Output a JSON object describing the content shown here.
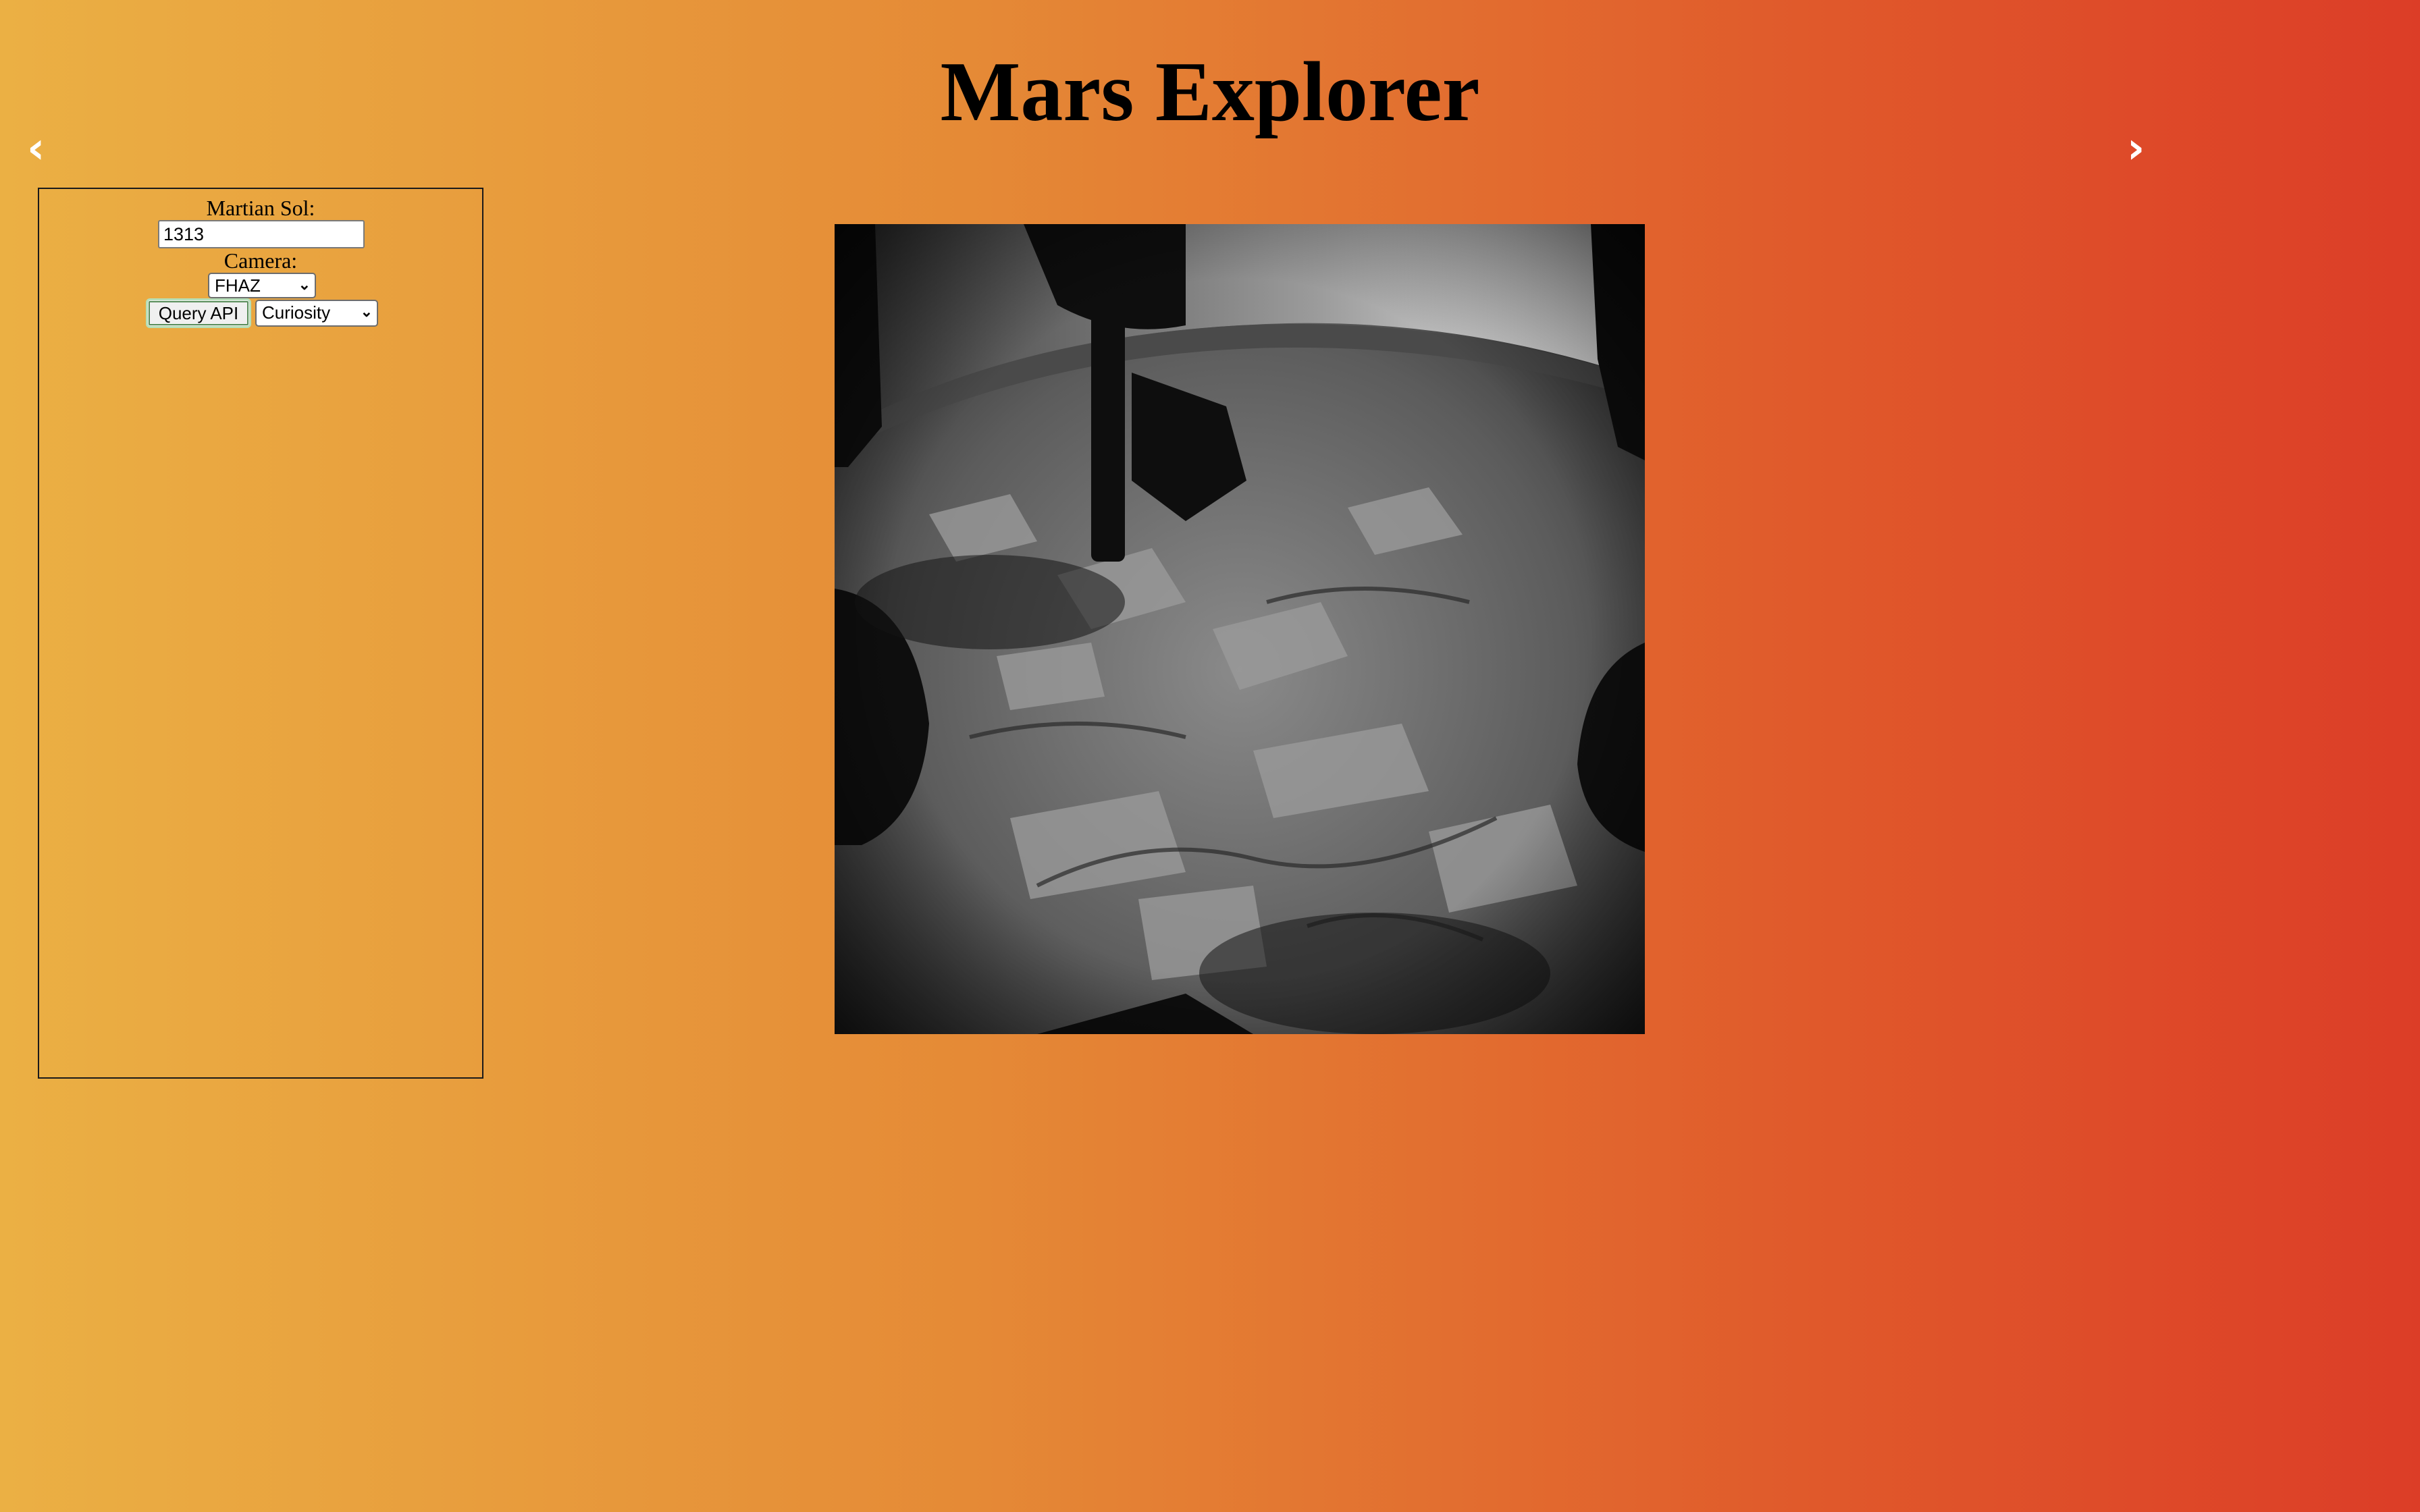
{
  "page": {
    "title": "Mars Explorer",
    "gradient_colors": [
      "#ebb044",
      "#e58a36",
      "#e0592b",
      "#dc3d27"
    ]
  },
  "nav": {
    "prev_label": "‹",
    "next_label": "›",
    "prev_icon": "chevron-left-icon",
    "next_icon": "chevron-right-icon"
  },
  "controls": {
    "sol_label": "Martian Sol:",
    "sol_value": "1313",
    "camera_label": "Camera:",
    "camera_selected": "FHAZ",
    "query_button_label": "Query API",
    "rover_selected": "Curiosity"
  },
  "photo": {
    "alt": "Mars rover photo"
  }
}
